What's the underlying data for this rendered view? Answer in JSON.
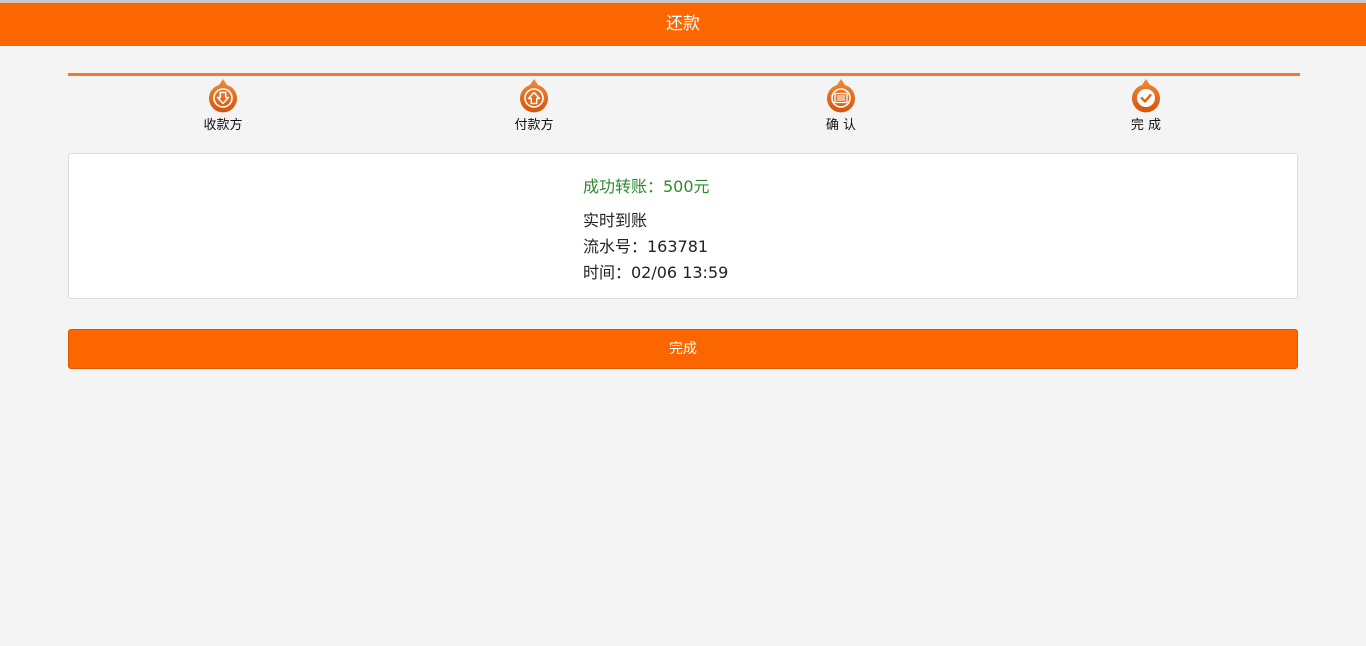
{
  "header": {
    "title": "还款"
  },
  "steps": [
    {
      "label": "收款方",
      "icon": "arrow-down-icon"
    },
    {
      "label": "付款方",
      "icon": "arrow-up-icon"
    },
    {
      "label": "确 认",
      "icon": "list-icon"
    },
    {
      "label": "完 成",
      "icon": "checkmark-icon"
    }
  ],
  "result": {
    "success_text": "成功转账：500元",
    "arrival": "实时到账",
    "serial": "流水号：163781",
    "time": "时间：02/06 13:59"
  },
  "actions": {
    "done_label": "完成"
  },
  "colors": {
    "brand": "#fc6600",
    "success": "#2e8a2e",
    "background": "#f4f4f4"
  }
}
